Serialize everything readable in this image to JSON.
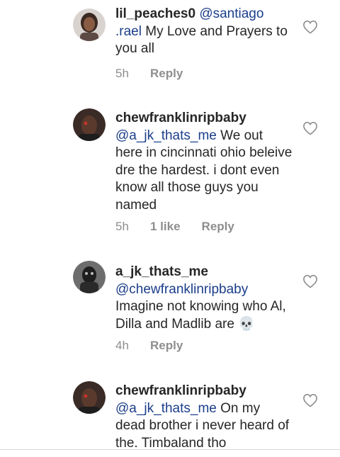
{
  "comments": [
    {
      "username": "lil_peaches0",
      "mention": "@santiago.rael",
      "mention_parts": [
        "@santiago",
        ".rael"
      ],
      "text": "My Love and Prayers to you all",
      "time": "5h",
      "likes": "",
      "reply": "Reply",
      "avatar": "user-avatar-woman"
    },
    {
      "username": "chewfranklinripbaby",
      "mention": "@a_jk_thats_me",
      "text": "We out here in cincinnati ohio beleive dre the hardest. i dont even know all those guys you named",
      "time": "5h",
      "likes": "1 like",
      "reply": "Reply",
      "avatar": "user-avatar-man"
    },
    {
      "username": "a_jk_thats_me",
      "mention": "@chewfranklinripbaby",
      "text": "Imagine not knowing who Al, Dilla and Madlib are",
      "emoji": "💀",
      "time": "4h",
      "likes": "",
      "reply": "Reply",
      "avatar": "user-avatar-masked"
    },
    {
      "username": "chewfranklinripbaby",
      "mention": "@a_jk_thats_me",
      "text": "On my dead brother i never heard of the. Timbaland tho",
      "time": "",
      "likes": "",
      "reply": "",
      "avatar": "user-avatar-man"
    }
  ],
  "icons": {
    "like": "heart-outline-icon"
  },
  "colors": {
    "mention": "#1b3e8a",
    "meta": "#8e8e8e",
    "text": "#262626"
  }
}
